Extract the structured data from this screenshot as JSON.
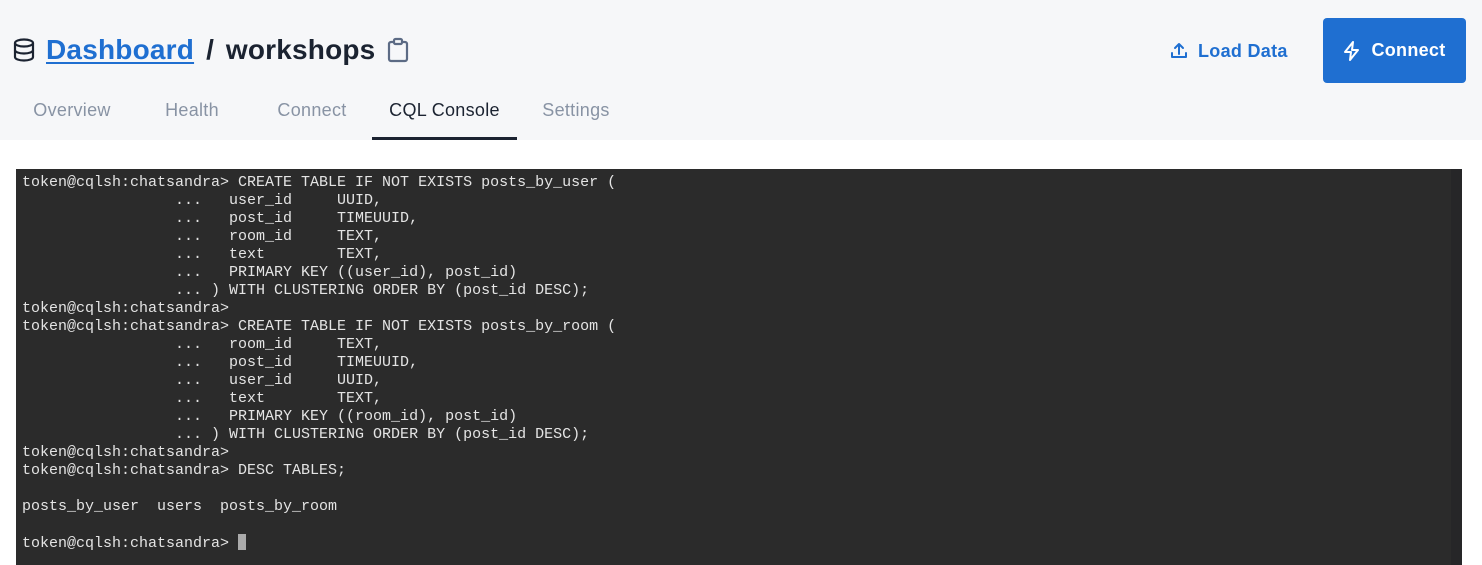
{
  "header": {
    "breadcrumb_root": "Dashboard",
    "separator": "/",
    "database_name": "workshops",
    "icons": {
      "database": "database-icon",
      "copy": "clipboard-icon",
      "upload": "upload-icon",
      "bolt": "lightning-bolt-icon"
    },
    "load_data_label": "Load Data",
    "connect_label": "Connect",
    "accent_color": "#1f6fd1"
  },
  "tabs": [
    {
      "label": "Overview",
      "active": false
    },
    {
      "label": "Health",
      "active": false
    },
    {
      "label": "Connect",
      "active": false
    },
    {
      "label": "CQL Console",
      "active": true
    },
    {
      "label": "Settings",
      "active": false
    }
  ],
  "console": {
    "lines": [
      "token@cqlsh:chatsandra> CREATE TABLE IF NOT EXISTS posts_by_user (",
      "                 ...   user_id     UUID,",
      "                 ...   post_id     TIMEUUID,",
      "                 ...   room_id     TEXT,",
      "                 ...   text        TEXT,",
      "                 ...   PRIMARY KEY ((user_id), post_id)",
      "                 ... ) WITH CLUSTERING ORDER BY (post_id DESC);",
      "token@cqlsh:chatsandra>",
      "token@cqlsh:chatsandra> CREATE TABLE IF NOT EXISTS posts_by_room (",
      "                 ...   room_id     TEXT,",
      "                 ...   post_id     TIMEUUID,",
      "                 ...   user_id     UUID,",
      "                 ...   text        TEXT,",
      "                 ...   PRIMARY KEY ((room_id), post_id)",
      "                 ... ) WITH CLUSTERING ORDER BY (post_id DESC);",
      "token@cqlsh:chatsandra>",
      "token@cqlsh:chatsandra> DESC TABLES;",
      "",
      "posts_by_user  users  posts_by_room",
      ""
    ],
    "prompt": "token@cqlsh:chatsandra> ",
    "input_value": ""
  }
}
